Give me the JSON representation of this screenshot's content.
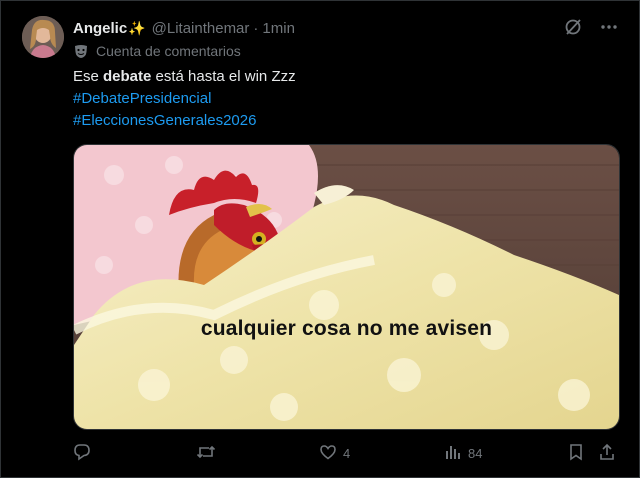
{
  "post": {
    "author_name": "Angelic",
    "author_emoji": "✨",
    "handle": "@Litainthemar",
    "separator": "·",
    "time": "1min",
    "community_label": "Cuenta de comentarios",
    "text_before_bold": "Ese ",
    "text_bold": "debate",
    "text_after_bold": " está hasta el win Zzz",
    "hashtags": [
      "#DebatePresidencial",
      "#EleccionesGenerales2026"
    ],
    "media_caption": "cualquier cosa no me avisen"
  },
  "actions": {
    "reply_count": "",
    "repost_count": "",
    "like_count": "4",
    "views_count": "84"
  },
  "icons": {
    "grok": "grok-slash-icon",
    "more": "more-dots-icon",
    "community": "theater-mask-icon",
    "reply": "reply-bubble-icon",
    "repost": "repost-icon",
    "like": "heart-icon",
    "views": "views-bars-icon",
    "bookmark": "bookmark-icon",
    "share": "share-icon"
  },
  "colors": {
    "background": "#000000",
    "text": "#e7e9ea",
    "muted": "#71767b",
    "link": "#1d9bf0"
  }
}
